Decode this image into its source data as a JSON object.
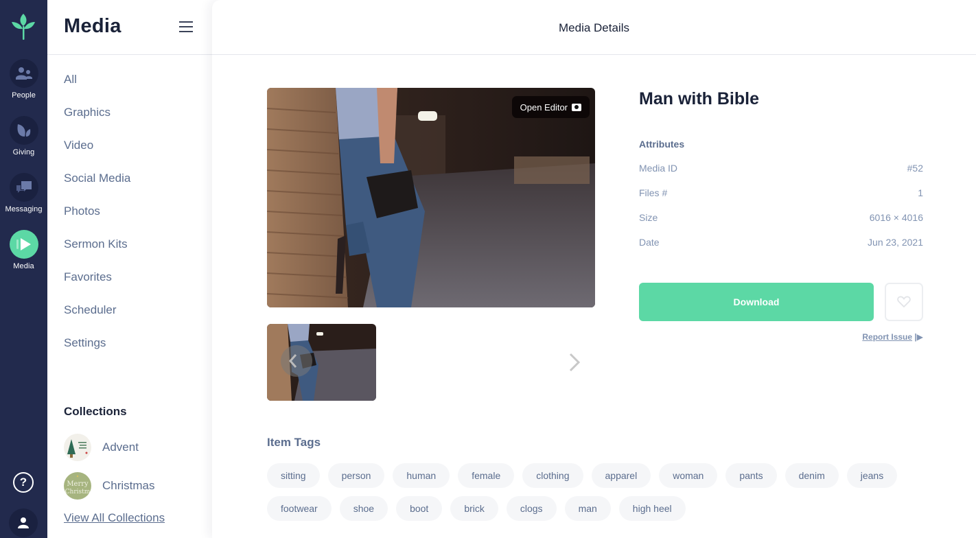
{
  "rail": {
    "items": [
      {
        "label": "People",
        "icon": "people-icon"
      },
      {
        "label": "Giving",
        "icon": "giving-icon"
      },
      {
        "label": "Messaging",
        "icon": "messaging-icon"
      },
      {
        "label": "Media",
        "icon": "media-play-icon",
        "active": true
      }
    ],
    "help_symbol": "?"
  },
  "sidebar": {
    "title": "Media",
    "nav": [
      "All",
      "Graphics",
      "Video",
      "Social Media",
      "Photos",
      "Sermon Kits",
      "Favorites",
      "Scheduler",
      "Settings"
    ],
    "collections_title": "Collections",
    "collections": [
      {
        "name": "Advent"
      },
      {
        "name": "Christmas"
      }
    ],
    "view_all": "View All Collections"
  },
  "main": {
    "header_title": "Media Details",
    "open_editor_label": "Open Editor",
    "media": {
      "title": "Man with Bible",
      "attributes_heading": "Attributes",
      "attributes": [
        {
          "label": "Media ID",
          "value": "#52"
        },
        {
          "label": "Files #",
          "value": "1"
        },
        {
          "label": "Size",
          "value": "6016 × 4016"
        },
        {
          "label": "Date",
          "value": "Jun 23, 2021"
        }
      ]
    },
    "download_label": "Download",
    "report_label": "Report Issue",
    "report_symbol": "|▶",
    "tags_heading": "Item Tags",
    "tags": [
      "sitting",
      "person",
      "human",
      "female",
      "clothing",
      "apparel",
      "woman",
      "pants",
      "denim",
      "jeans",
      "footwear",
      "shoe",
      "boot",
      "brick",
      "clogs",
      "man",
      "high heel"
    ]
  },
  "colors": {
    "rail_bg": "#222a4d",
    "accent_green": "#5cd8a5",
    "text_dark": "#1a2238",
    "text_muted": "#5b6d8e"
  }
}
